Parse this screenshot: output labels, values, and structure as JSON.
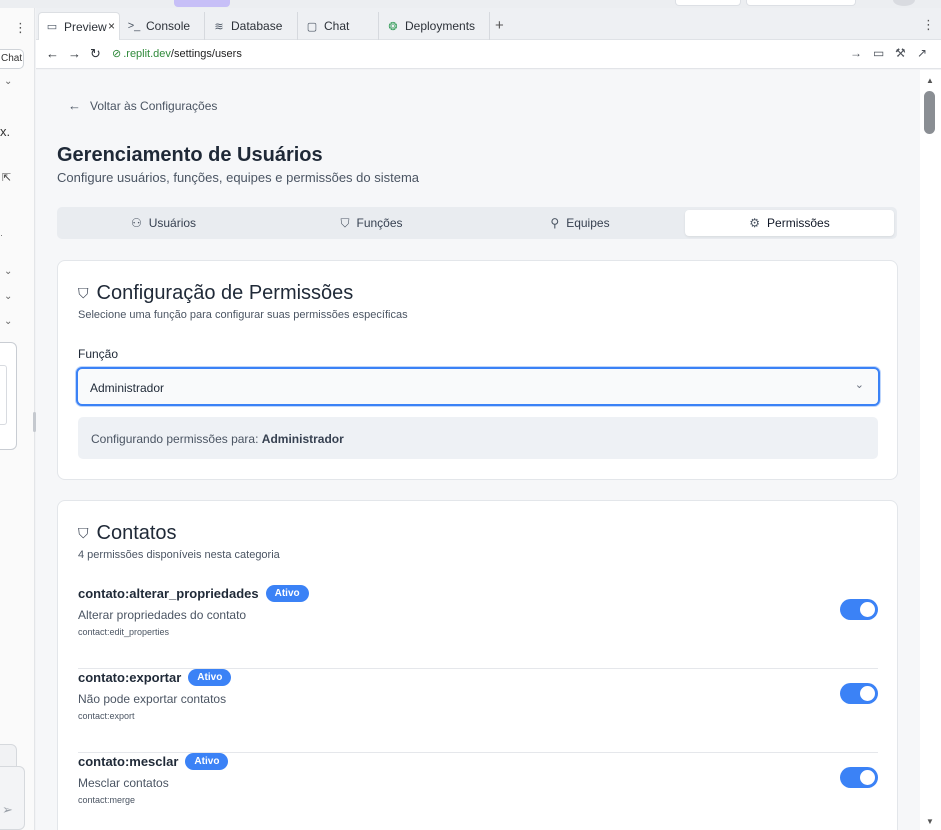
{
  "browser": {
    "tabs": [
      {
        "label": "Preview",
        "icon": "monitor-icon"
      },
      {
        "label": "Console",
        "icon": "terminal-icon"
      },
      {
        "label": "Database",
        "icon": "database-icon"
      },
      {
        "label": "Chat",
        "icon": "chat-icon"
      },
      {
        "label": "Deployments",
        "icon": "deployments-icon"
      }
    ],
    "left_chat_button": "Chat",
    "url_domain": ".replit.dev",
    "url_path": "/settings/users"
  },
  "page": {
    "back_label": "Voltar às Configurações",
    "title": "Gerenciamento de Usuários",
    "subtitle": "Configure usuários, funções, equipes e permissões do sistema",
    "tabs": [
      {
        "label": "Usuários",
        "icon": "users-icon",
        "active": false
      },
      {
        "label": "Funções",
        "icon": "shield-icon",
        "active": false
      },
      {
        "label": "Equipes",
        "icon": "user-check-icon",
        "active": false
      },
      {
        "label": "Permissões",
        "icon": "gear-icon",
        "active": true
      }
    ]
  },
  "config_card": {
    "title": "Configuração de Permissões",
    "subtitle": "Selecione uma função para configurar suas permissões específicas",
    "role_label": "Função",
    "role_value": "Administrador",
    "info_prefix": "Configurando permissões para:",
    "info_role": "Administrador"
  },
  "contacts_card": {
    "title": "Contatos",
    "subtitle": "4 permissões disponíveis nesta categoria",
    "permissions": [
      {
        "name": "contato:alterar_propriedades",
        "badge": "Ativo",
        "description": "Alterar propriedades do contato",
        "key": "contact:edit_properties",
        "enabled": true
      },
      {
        "name": "contato:exportar",
        "badge": "Ativo",
        "description": "Não pode exportar contatos",
        "key": "contact:export",
        "enabled": true
      },
      {
        "name": "contato:mesclar",
        "badge": "Ativo",
        "description": "Mesclar contatos",
        "key": "contact:merge",
        "enabled": true
      }
    ]
  },
  "colors": {
    "accent": "#3b82f6",
    "badge_text": "#ffffff"
  }
}
